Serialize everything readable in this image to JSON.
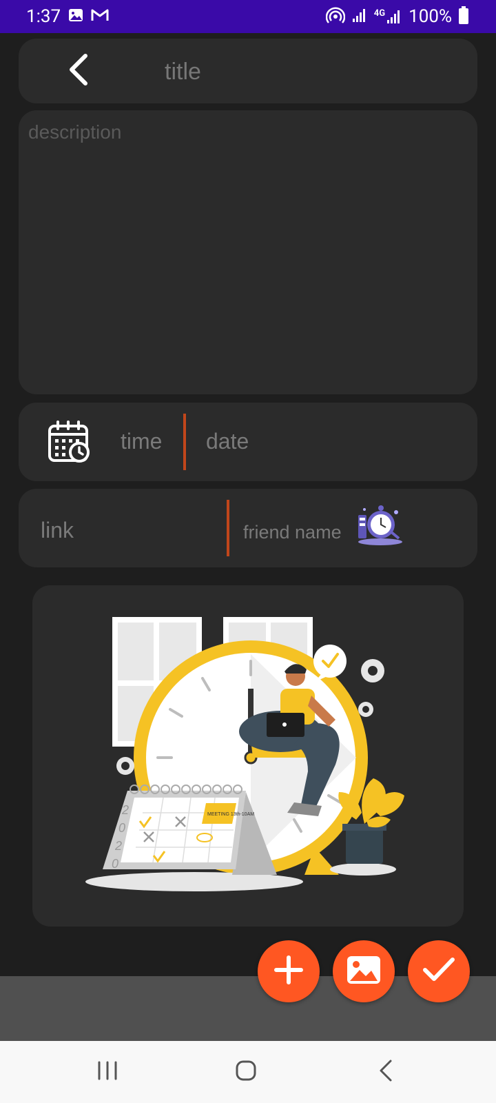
{
  "status_bar": {
    "time": "1:37",
    "battery": "100%",
    "network": "4G",
    "icons": [
      "image-notification-icon",
      "gmail-icon",
      "hotspot-icon",
      "signal-icon",
      "signal-4g-icon",
      "battery-icon"
    ]
  },
  "title_field": {
    "placeholder": "title",
    "value": ""
  },
  "description_field": {
    "placeholder": "description",
    "value": ""
  },
  "time_date": {
    "time_label": "time",
    "date_label": "date",
    "icon": "calendar-clock-icon"
  },
  "link_friend": {
    "link_label": "link",
    "friend_label": "friend name",
    "icon": "alarm-clock-illustration-icon"
  },
  "illustration": {
    "name": "time-management-illustration",
    "calendar_note": "MEETING 13th-10AM",
    "calendar_year": [
      "2",
      "0",
      "2",
      "0"
    ]
  },
  "fabs": [
    {
      "name": "add-button",
      "icon": "plus-icon"
    },
    {
      "name": "add-image-button",
      "icon": "image-icon"
    },
    {
      "name": "save-button",
      "icon": "check-icon"
    }
  ],
  "colors": {
    "status_bar": "#3a0aa8",
    "background": "#1e1e1e",
    "card": "#2b2b2b",
    "accent": "#ff5722",
    "divider": "#c1461b",
    "placeholder": "#777777",
    "illustration_yellow": "#f5c224"
  },
  "nav_bar": {
    "buttons": [
      "recents-button",
      "home-button",
      "back-button"
    ]
  }
}
